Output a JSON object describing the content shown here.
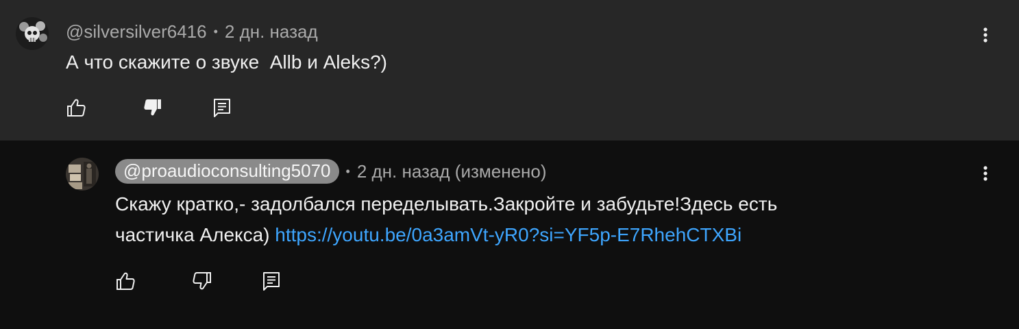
{
  "comments": [
    {
      "author": "@silversilver6416",
      "separator": "•",
      "time": "2 дн. назад",
      "text": "А что скажите о звуке  Allb и Aleks?)",
      "icons": {
        "like": "thumb-up-icon",
        "dislike": "thumb-down-filled-icon",
        "reply": "reply-icon",
        "menu": "more-vert-icon"
      }
    },
    {
      "author": "@proaudioconsulting5070",
      "separator": "•",
      "time": "2 дн. назад (изменено)",
      "text_line1": "Скажу кратко,- задолбался переделывать.Закройте и забудьте!Здесь есть",
      "text_line2": "частичка Алекса)",
      "link": "https://youtu.be/0a3amVt-yR0?si=YF5p-E7RhehCTXBi",
      "icons": {
        "like": "thumb-up-icon",
        "dislike": "thumb-down-icon",
        "reply": "reply-icon",
        "menu": "more-vert-icon"
      }
    }
  ],
  "colors": {
    "top_bg": "#272727",
    "reply_bg": "#0f0f0f",
    "link": "#3ea6ff",
    "muted": "#aaaaaa",
    "pill": "#8a8a8a"
  }
}
